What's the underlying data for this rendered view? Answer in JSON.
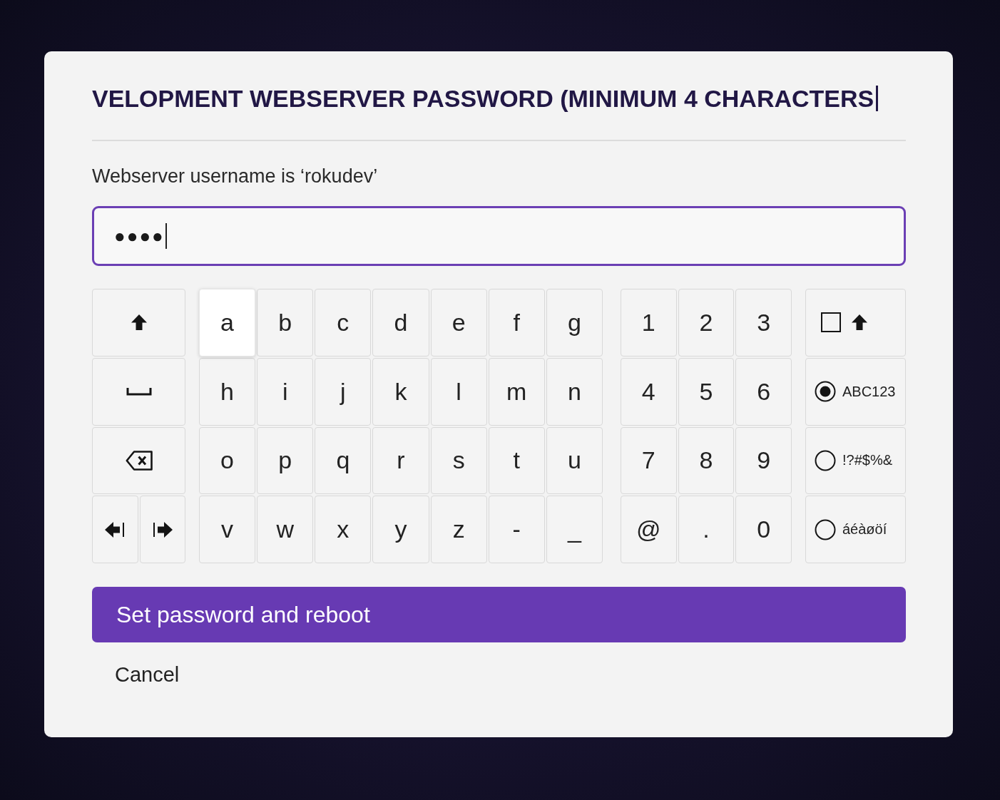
{
  "dialog": {
    "title": "VELOPMENT WEBSERVER PASSWORD (MINIMUM 4 CHARACTERS",
    "subtitle": "Webserver username is ‘rokudev’"
  },
  "password_field": {
    "value": "●●●●"
  },
  "keyboard": {
    "letter_keys": [
      {
        "label": "a",
        "selected": true
      },
      {
        "label": "b",
        "selected": false
      },
      {
        "label": "c",
        "selected": false
      },
      {
        "label": "d",
        "selected": false
      },
      {
        "label": "e",
        "selected": false
      },
      {
        "label": "f",
        "selected": false
      },
      {
        "label": "g",
        "selected": false
      },
      {
        "label": "h",
        "selected": false
      },
      {
        "label": "i",
        "selected": false
      },
      {
        "label": "j",
        "selected": false
      },
      {
        "label": "k",
        "selected": false
      },
      {
        "label": "l",
        "selected": false
      },
      {
        "label": "m",
        "selected": false
      },
      {
        "label": "n",
        "selected": false
      },
      {
        "label": "o",
        "selected": false
      },
      {
        "label": "p",
        "selected": false
      },
      {
        "label": "q",
        "selected": false
      },
      {
        "label": "r",
        "selected": false
      },
      {
        "label": "s",
        "selected": false
      },
      {
        "label": "t",
        "selected": false
      },
      {
        "label": "u",
        "selected": false
      },
      {
        "label": "v",
        "selected": false
      },
      {
        "label": "w",
        "selected": false
      },
      {
        "label": "x",
        "selected": false
      },
      {
        "label": "y",
        "selected": false
      },
      {
        "label": "z",
        "selected": false
      },
      {
        "label": "-",
        "selected": false
      },
      {
        "label": "_",
        "selected": false
      }
    ],
    "number_keys": [
      {
        "label": "1",
        "selected": false
      },
      {
        "label": "2",
        "selected": false
      },
      {
        "label": "3",
        "selected": false
      },
      {
        "label": "4",
        "selected": false
      },
      {
        "label": "5",
        "selected": false
      },
      {
        "label": "6",
        "selected": false
      },
      {
        "label": "7",
        "selected": false
      },
      {
        "label": "8",
        "selected": false
      },
      {
        "label": "9",
        "selected": false
      },
      {
        "label": "@",
        "selected": false
      },
      {
        "label": ".",
        "selected": false
      },
      {
        "label": "0",
        "selected": false
      }
    ],
    "caps_lock": {
      "checked": false
    },
    "modes": [
      {
        "label": "ABC123",
        "selected": true
      },
      {
        "label": "!?#$%&",
        "selected": false
      },
      {
        "label": "áéàøöí",
        "selected": false
      }
    ]
  },
  "buttons": {
    "primary": "Set password and reboot",
    "cancel": "Cancel"
  }
}
